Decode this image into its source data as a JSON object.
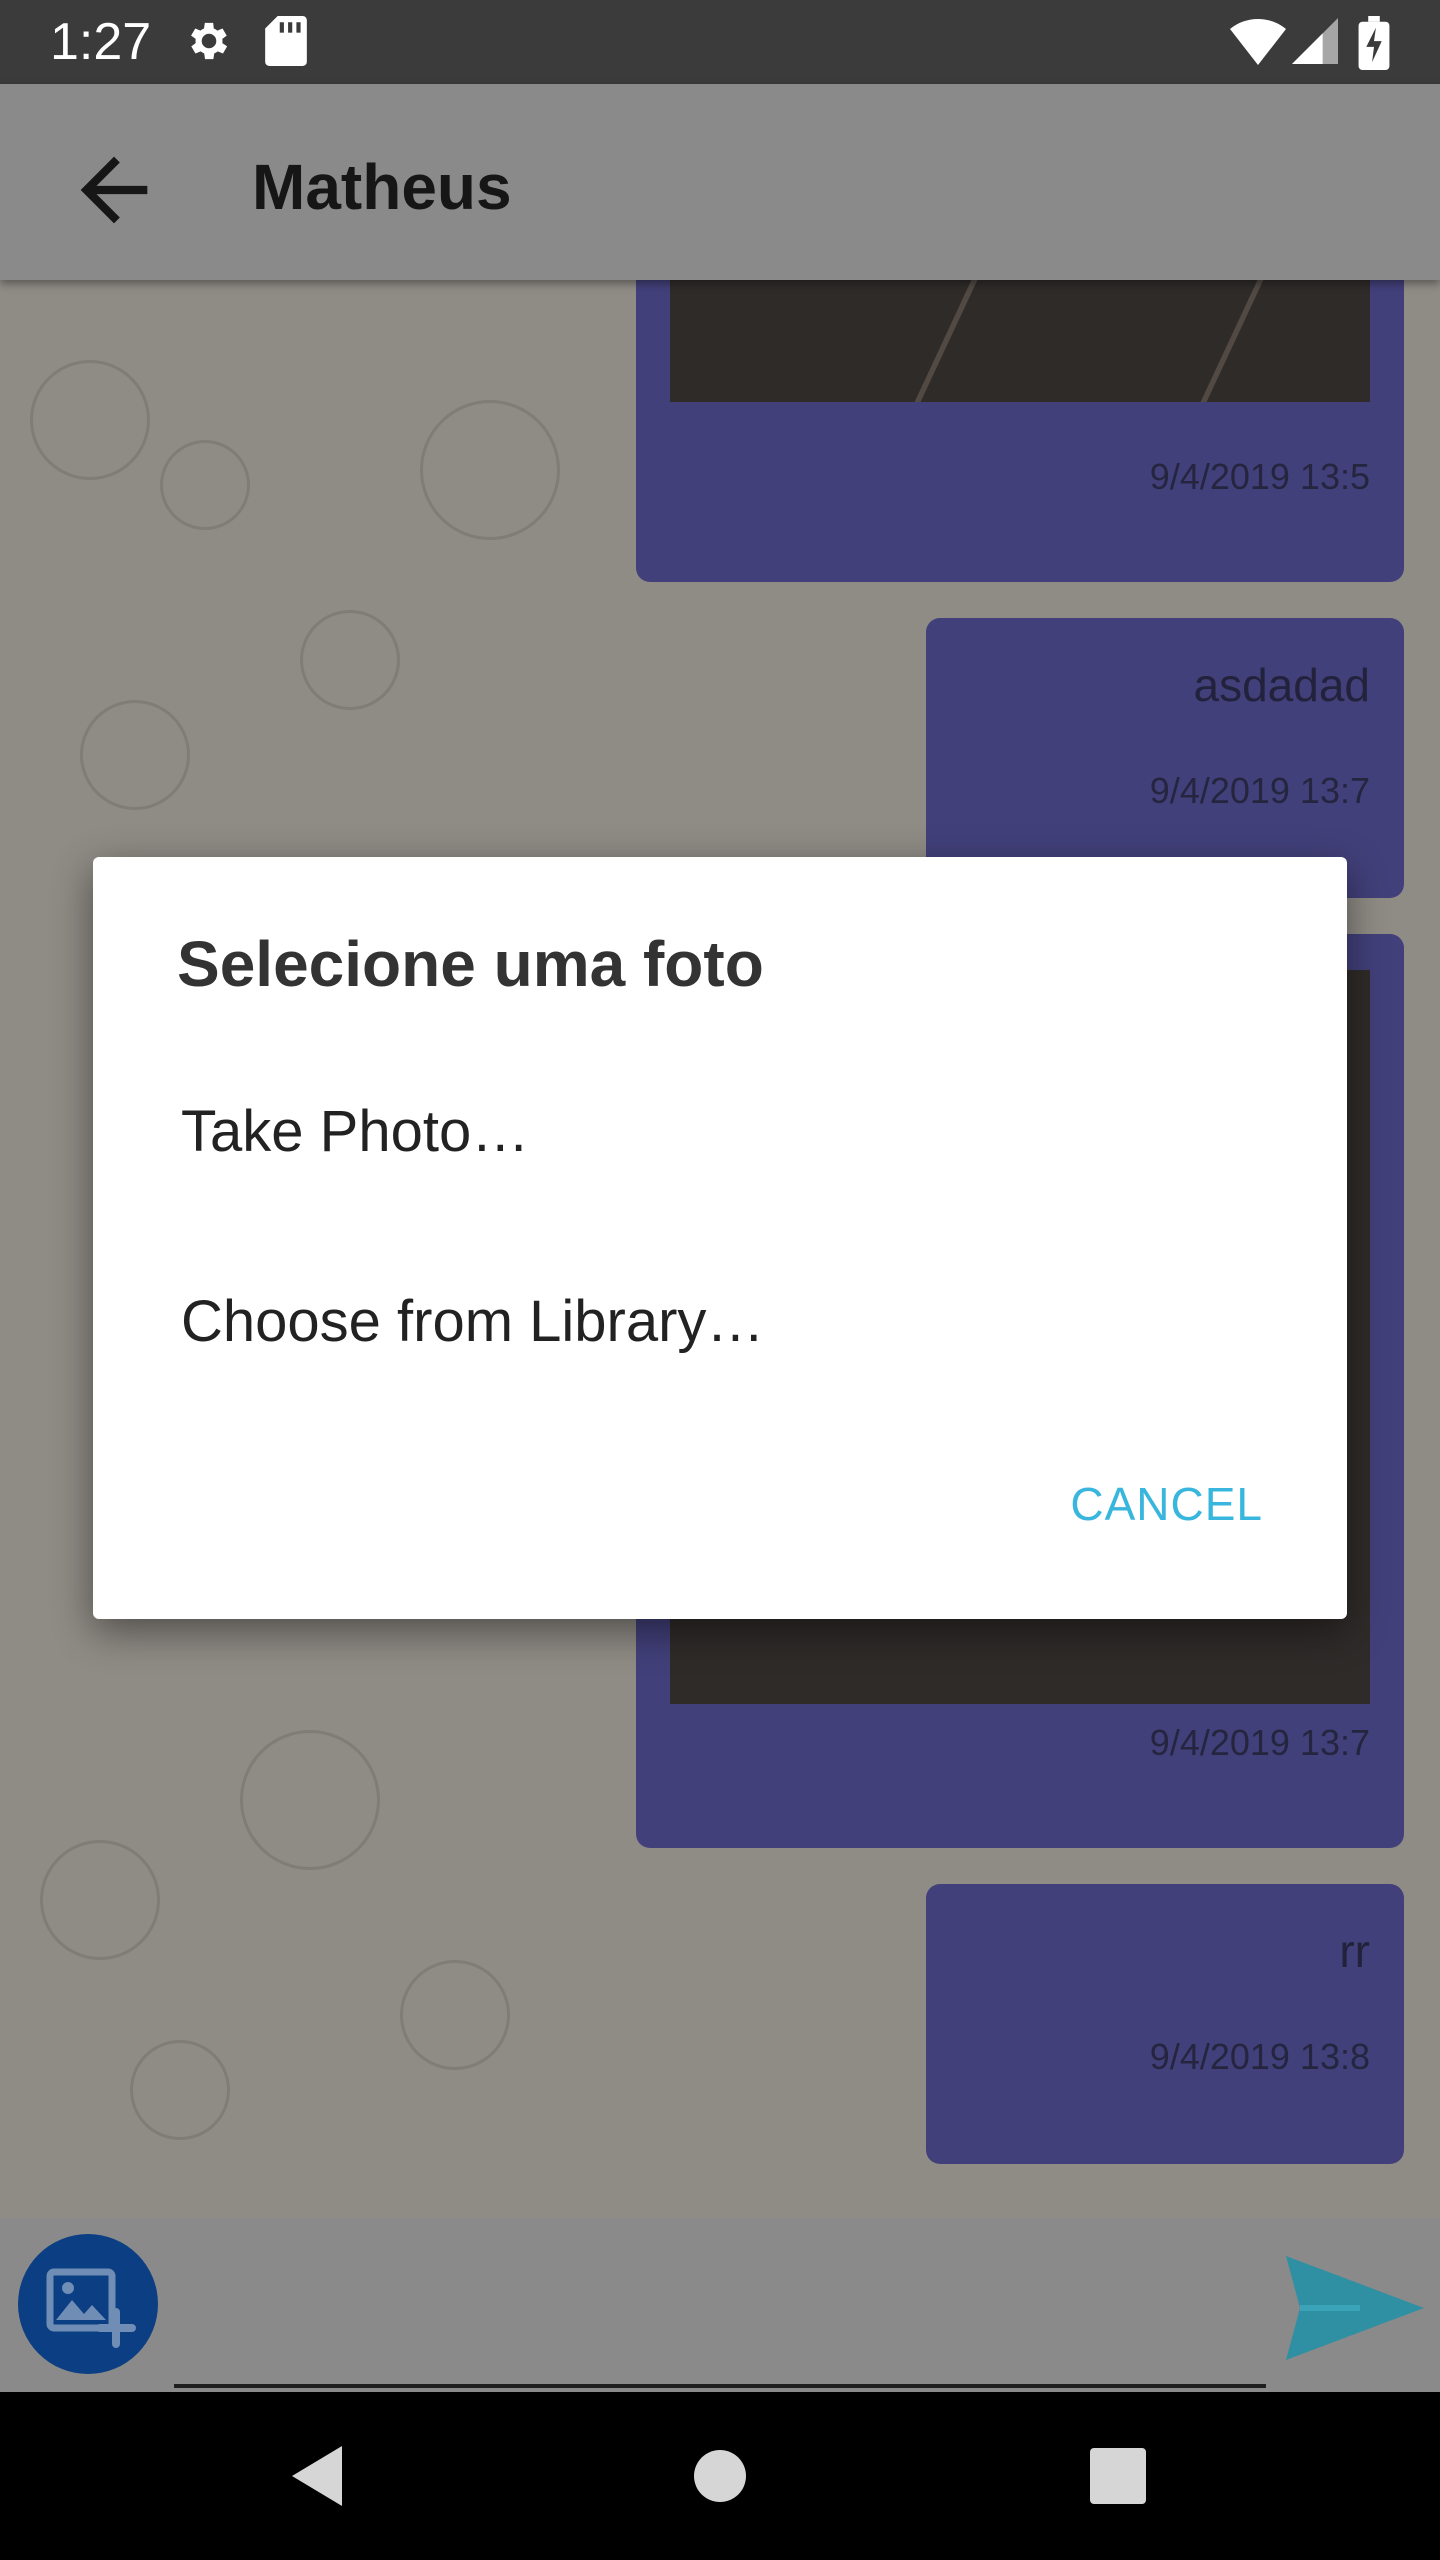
{
  "status_bar": {
    "time": "1:27",
    "icons": [
      "gear-icon",
      "sd-card-icon",
      "wifi-icon",
      "signal-icon",
      "battery-charging-icon"
    ]
  },
  "app_bar": {
    "title": "Matheus",
    "back_icon": "arrow-left-icon"
  },
  "messages": [
    {
      "type": "image",
      "time": "9/4/2019 13:5"
    },
    {
      "type": "text",
      "text": "asdadad",
      "time": "9/4/2019 13:7"
    },
    {
      "type": "image",
      "time": "9/4/2019 13:7"
    },
    {
      "type": "text",
      "text": "rr",
      "time": "9/4/2019 13:8"
    }
  ],
  "composer": {
    "image_button_icon": "add-photo-icon",
    "input_value": "",
    "send_icon": "send-icon"
  },
  "dialog": {
    "title": "Selecione uma foto",
    "options": [
      "Take Photo…",
      "Choose from Library…"
    ],
    "cancel_label": "CANCEL"
  },
  "nav_bar": {
    "icons": [
      "back-triangle-icon",
      "home-circle-icon",
      "recents-square-icon"
    ]
  },
  "colors": {
    "bubble": "#42407a",
    "accent": "#39b6de",
    "image_button": "#0b3e82",
    "send": "#2f8fa3"
  }
}
